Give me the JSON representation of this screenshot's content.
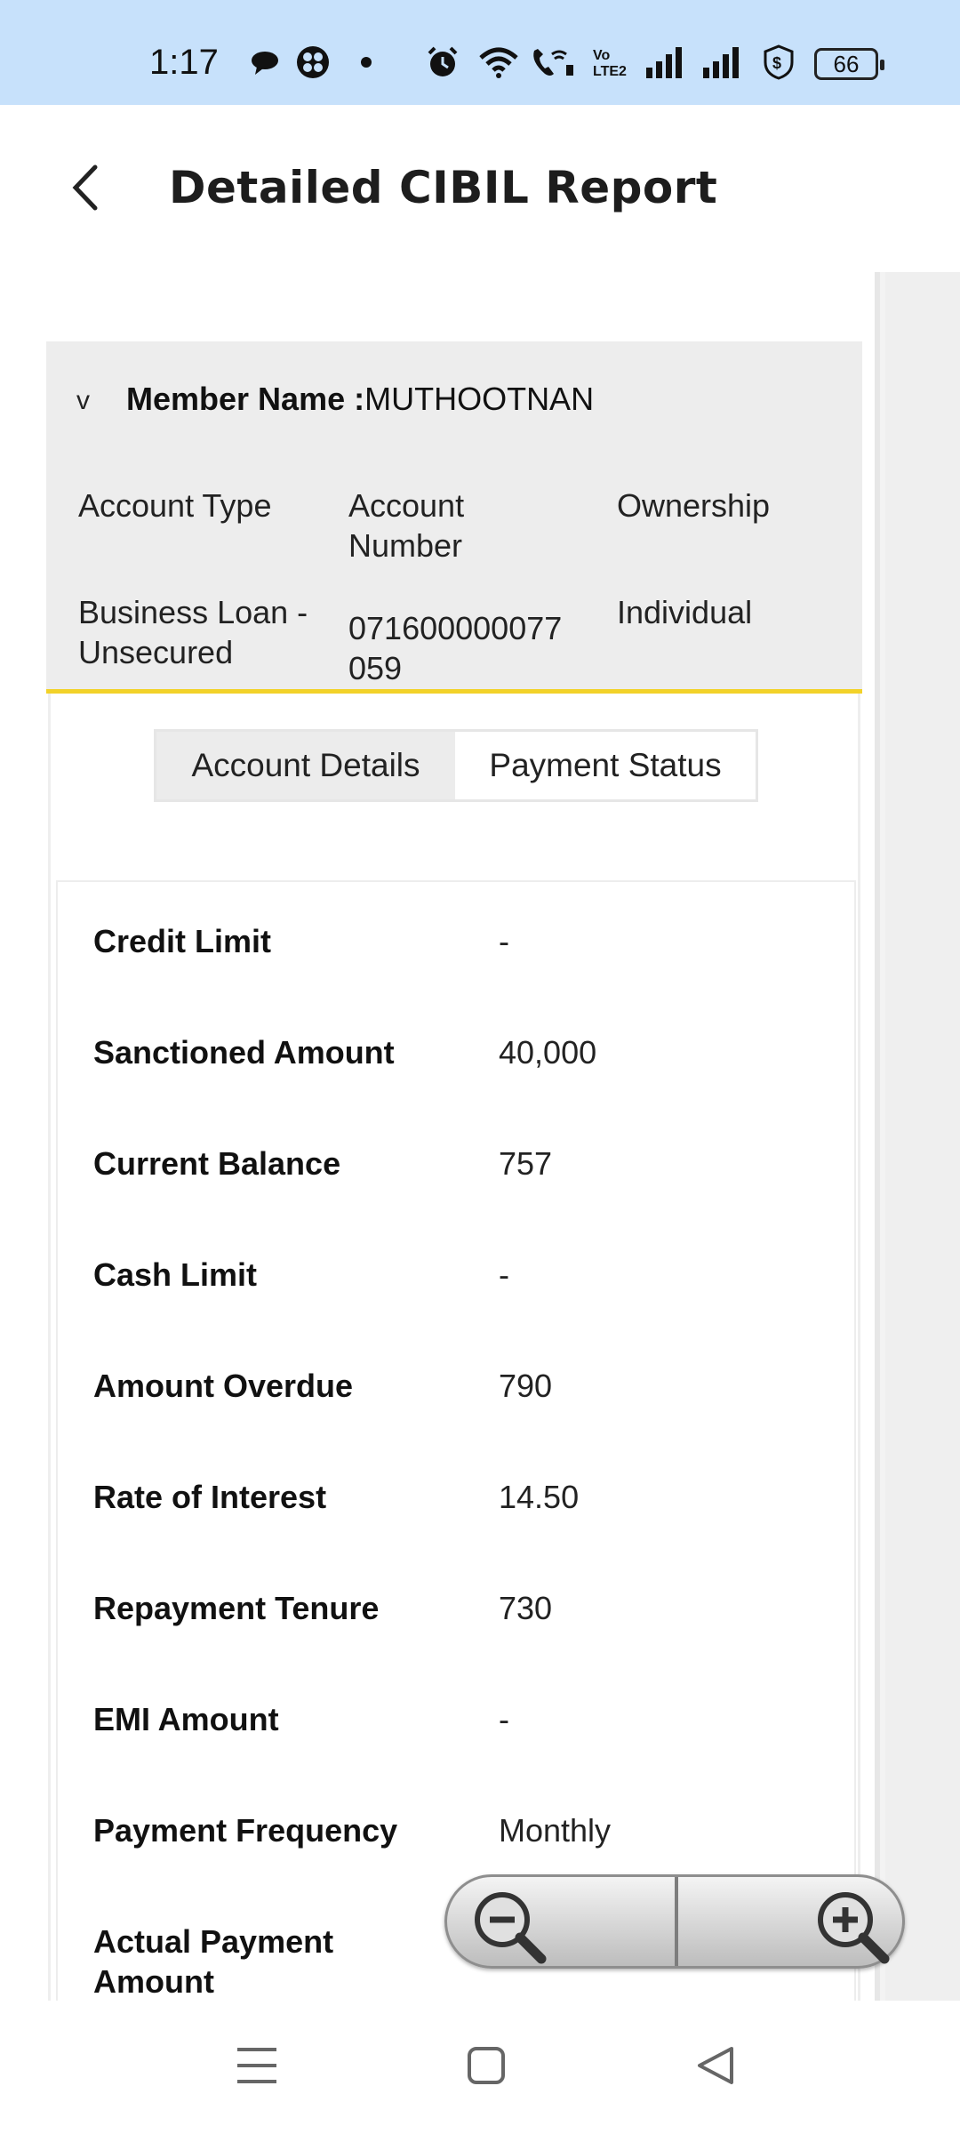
{
  "status_bar": {
    "time": "1:17",
    "battery": "66",
    "icons": [
      "chat-bubble-icon",
      "app-grid-icon",
      "dot-icon",
      "alarm-icon",
      "wifi-icon",
      "wifi-calling-icon",
      "volte-icon",
      "signal-icon",
      "signal-icon",
      "shield-dollar-icon",
      "battery-icon"
    ]
  },
  "app_bar": {
    "back_icon": "chevron-left-icon",
    "title": "Detailed CIBIL Report"
  },
  "member": {
    "toggle": "v",
    "label": "Member Name :",
    "value": "MUTHOOTNAN",
    "headers": {
      "account_type": "Account Type",
      "account_number": "Account Number",
      "ownership": "Ownership"
    },
    "values": {
      "account_type": "Business Loan - Unsecured",
      "account_number": "071600000077059",
      "ownership": "Individual"
    }
  },
  "tabs": [
    {
      "label": "Account Details",
      "active": true
    },
    {
      "label": "Payment Status",
      "active": false
    }
  ],
  "details": [
    {
      "label": "Credit Limit",
      "value": "-"
    },
    {
      "label": "Sanctioned Amount",
      "value": "40,000"
    },
    {
      "label": "Current Balance",
      "value": "757"
    },
    {
      "label": "Cash Limit",
      "value": "-"
    },
    {
      "label": "Amount Overdue",
      "value": "790"
    },
    {
      "label": "Rate of Interest",
      "value": "14.50"
    },
    {
      "label": "Repayment Tenure",
      "value": "730"
    },
    {
      "label": "EMI Amount",
      "value": "-"
    },
    {
      "label": "Payment Frequency",
      "value": "Monthly"
    },
    {
      "label": "Actual Payment Amount",
      "value": ""
    }
  ],
  "zoom": {
    "out_icon": "zoom-out-icon",
    "in_icon": "zoom-in-icon"
  },
  "nav_bar": {
    "icons": [
      "menu-icon",
      "home-square-icon",
      "back-triangle-icon"
    ]
  },
  "colors": {
    "status_bar": "#c7e1fb",
    "accent_underline": "#f2d229",
    "card_bg": "#ededed"
  }
}
